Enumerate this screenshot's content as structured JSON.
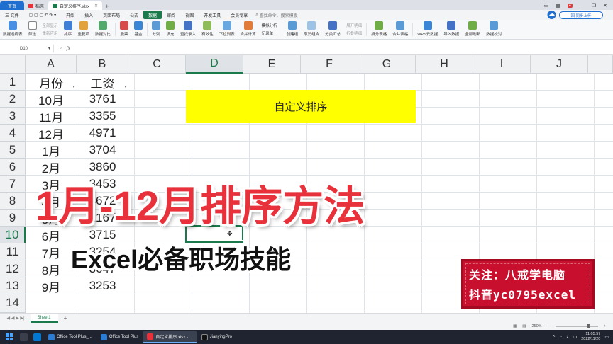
{
  "titlebar": {
    "home_tab": "首页",
    "tab1": "稻壳",
    "tab2": "自定义排序.xlsx",
    "new_tab": "+"
  },
  "menubar": {
    "items": [
      "三 文件",
      "开始",
      "插入",
      "页面布局",
      "公式",
      "数据",
      "审阅",
      "视图",
      "开发工具",
      "会员专享"
    ],
    "active_index": 5,
    "search_placeholder": "查找命令、搜索模板",
    "upload_label": "回 同步上传"
  },
  "ribbon": {
    "pivot": "数据透视表",
    "filter": "筛选",
    "show_all": "全部显示",
    "reapply": "重新应用",
    "sort": "排序",
    "duplicates": "重复项",
    "compare": "数据对比",
    "stock": "股票",
    "fund": "基金",
    "split": "分列",
    "fill": "填充",
    "input": "查找录入",
    "validity": "有效性",
    "dropdown": "下拉列表",
    "merge_calc": "合并计算",
    "simulate": "模拟分析",
    "record": "记录单",
    "group": "创建组",
    "ungroup": "取消组合",
    "subtotal": "分类汇总",
    "expand": "展开明细",
    "collapse": "折叠明细",
    "split_table": "拆分表格",
    "merge_table": "合并表格",
    "wps_cloud": "WPS云数据",
    "import": "导入数据",
    "refresh_all": "全部刷新",
    "verify": "数据校对"
  },
  "formulabar": {
    "cell_ref": "D10",
    "fx": "fx",
    "value": ""
  },
  "columns": [
    "A",
    "B",
    "C",
    "D",
    "E",
    "F",
    "G",
    "H",
    "I",
    "J"
  ],
  "active_column": "D",
  "rows": [
    "1",
    "2",
    "3",
    "4",
    "5",
    "6",
    "7",
    "8",
    "9",
    "10",
    "11",
    "12",
    "13",
    "14",
    "15"
  ],
  "active_row": "10",
  "table": {
    "header_a": "月份",
    "header_b": "工资",
    "months": [
      "10月",
      "11月",
      "12月",
      "1月",
      "2月",
      "3月",
      "4月",
      "5月",
      "6月",
      "7月",
      "8月",
      "9月"
    ],
    "salaries": [
      "3761",
      "3355",
      "4971",
      "3704",
      "3860",
      "3453",
      "4672",
      "2167",
      "3715",
      "3254",
      "3647",
      "3253"
    ]
  },
  "yellow_box_text": "自定义排序",
  "overlay": {
    "title": "1月-12月排序方法",
    "subtitle": "Excel必备职场技能",
    "title_color": "#e8313a"
  },
  "stamp": {
    "line1": "关注：八戒学电脑",
    "line2": "抖音yc0795excel",
    "color": "#c8102e"
  },
  "sheetbar": {
    "nav": "|◀ ◀ ▶ ▶|",
    "sheet": "Sheet1",
    "add": "+"
  },
  "statusbar": {
    "zoom": "250%"
  },
  "taskbar": {
    "apps": [
      "Office Tool Plus_...",
      "Office Tool Plus",
      "自定义排序.xlsx - ...",
      "JianyingPro"
    ],
    "active_index": 2,
    "time": "11:05:57",
    "date": "2022/11/20"
  },
  "colors": {
    "accent_green": "#1b7a4b",
    "brand_blue": "#1f6fd1",
    "highlight_yellow": "#ffff00"
  }
}
